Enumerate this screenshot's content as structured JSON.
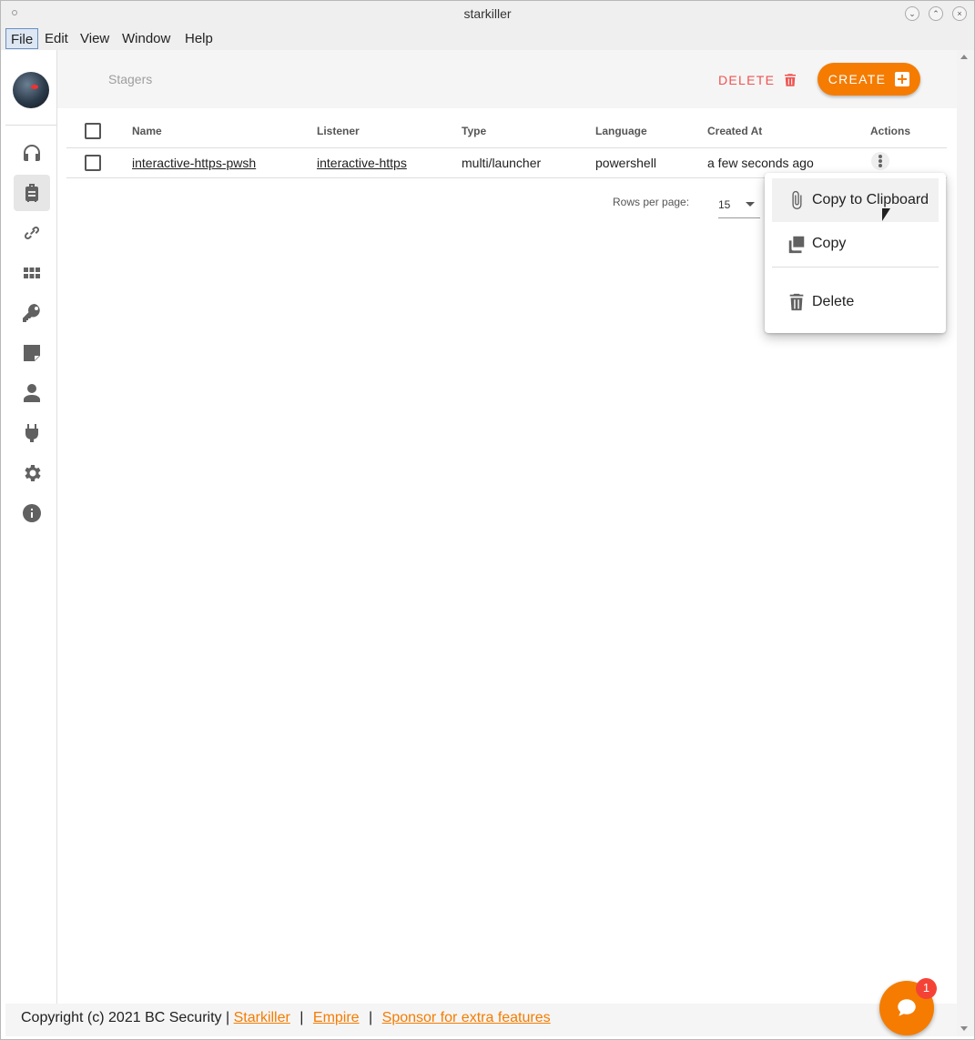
{
  "window": {
    "title": "starkiller"
  },
  "menubar": {
    "items": [
      "File",
      "Edit",
      "View",
      "Window",
      "Help"
    ]
  },
  "toolbar": {
    "page_title": "Stagers",
    "delete_label": "DELETE",
    "create_label": "CREATE"
  },
  "table": {
    "headers": [
      "Name",
      "Listener",
      "Type",
      "Language",
      "Created At",
      "Actions"
    ],
    "rows": [
      {
        "name": "interactive-https-pwsh",
        "listener": "interactive-https",
        "type": "multi/launcher",
        "language": "powershell",
        "created_at": "a few seconds ago"
      }
    ]
  },
  "pagination": {
    "rows_per_page_label": "Rows per page:",
    "rows_per_page_value": "15"
  },
  "context_menu": {
    "items": [
      "Copy to Clipboard",
      "Copy",
      "Delete"
    ]
  },
  "footer": {
    "copyright": "Copyright (c) 2021 BC Security |",
    "link_starkiller": "Starkiller",
    "link_empire": "Empire",
    "link_sponsor": "Sponsor for extra features",
    "sep": "|"
  },
  "chat": {
    "badge_count": "1"
  },
  "colors": {
    "accent": "#f57c00",
    "danger": "#ef5350"
  }
}
